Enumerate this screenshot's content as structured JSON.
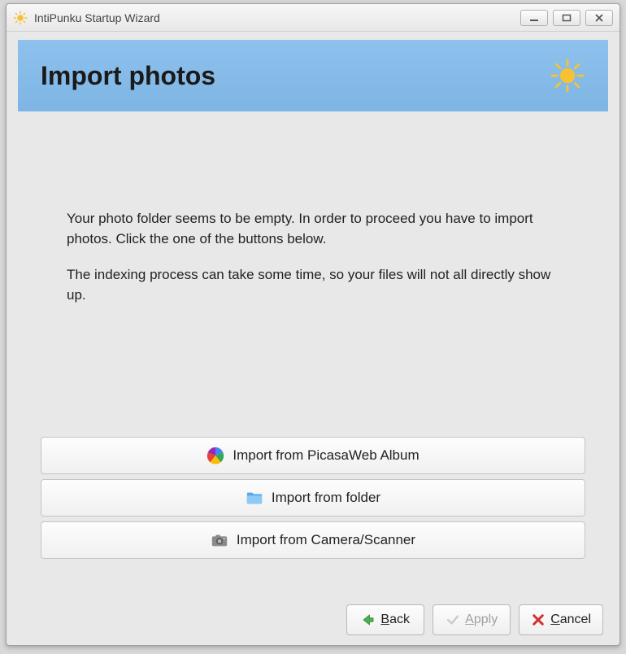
{
  "titlebar": {
    "title": "IntiPunku Startup Wizard"
  },
  "header": {
    "title": "Import photos"
  },
  "message": {
    "p1": "Your photo folder seems to be empty. In order to proceed you have to import photos. Click the one of the buttons below.",
    "p2": "The indexing process can take some time, so your files will not all directly show up."
  },
  "buttons": {
    "picasa": "Import from PicasaWeb Album",
    "folder": "Import from folder",
    "camera": "Import from Camera/Scanner"
  },
  "footer": {
    "back": "Back",
    "apply": "Apply",
    "cancel": "Cancel"
  }
}
